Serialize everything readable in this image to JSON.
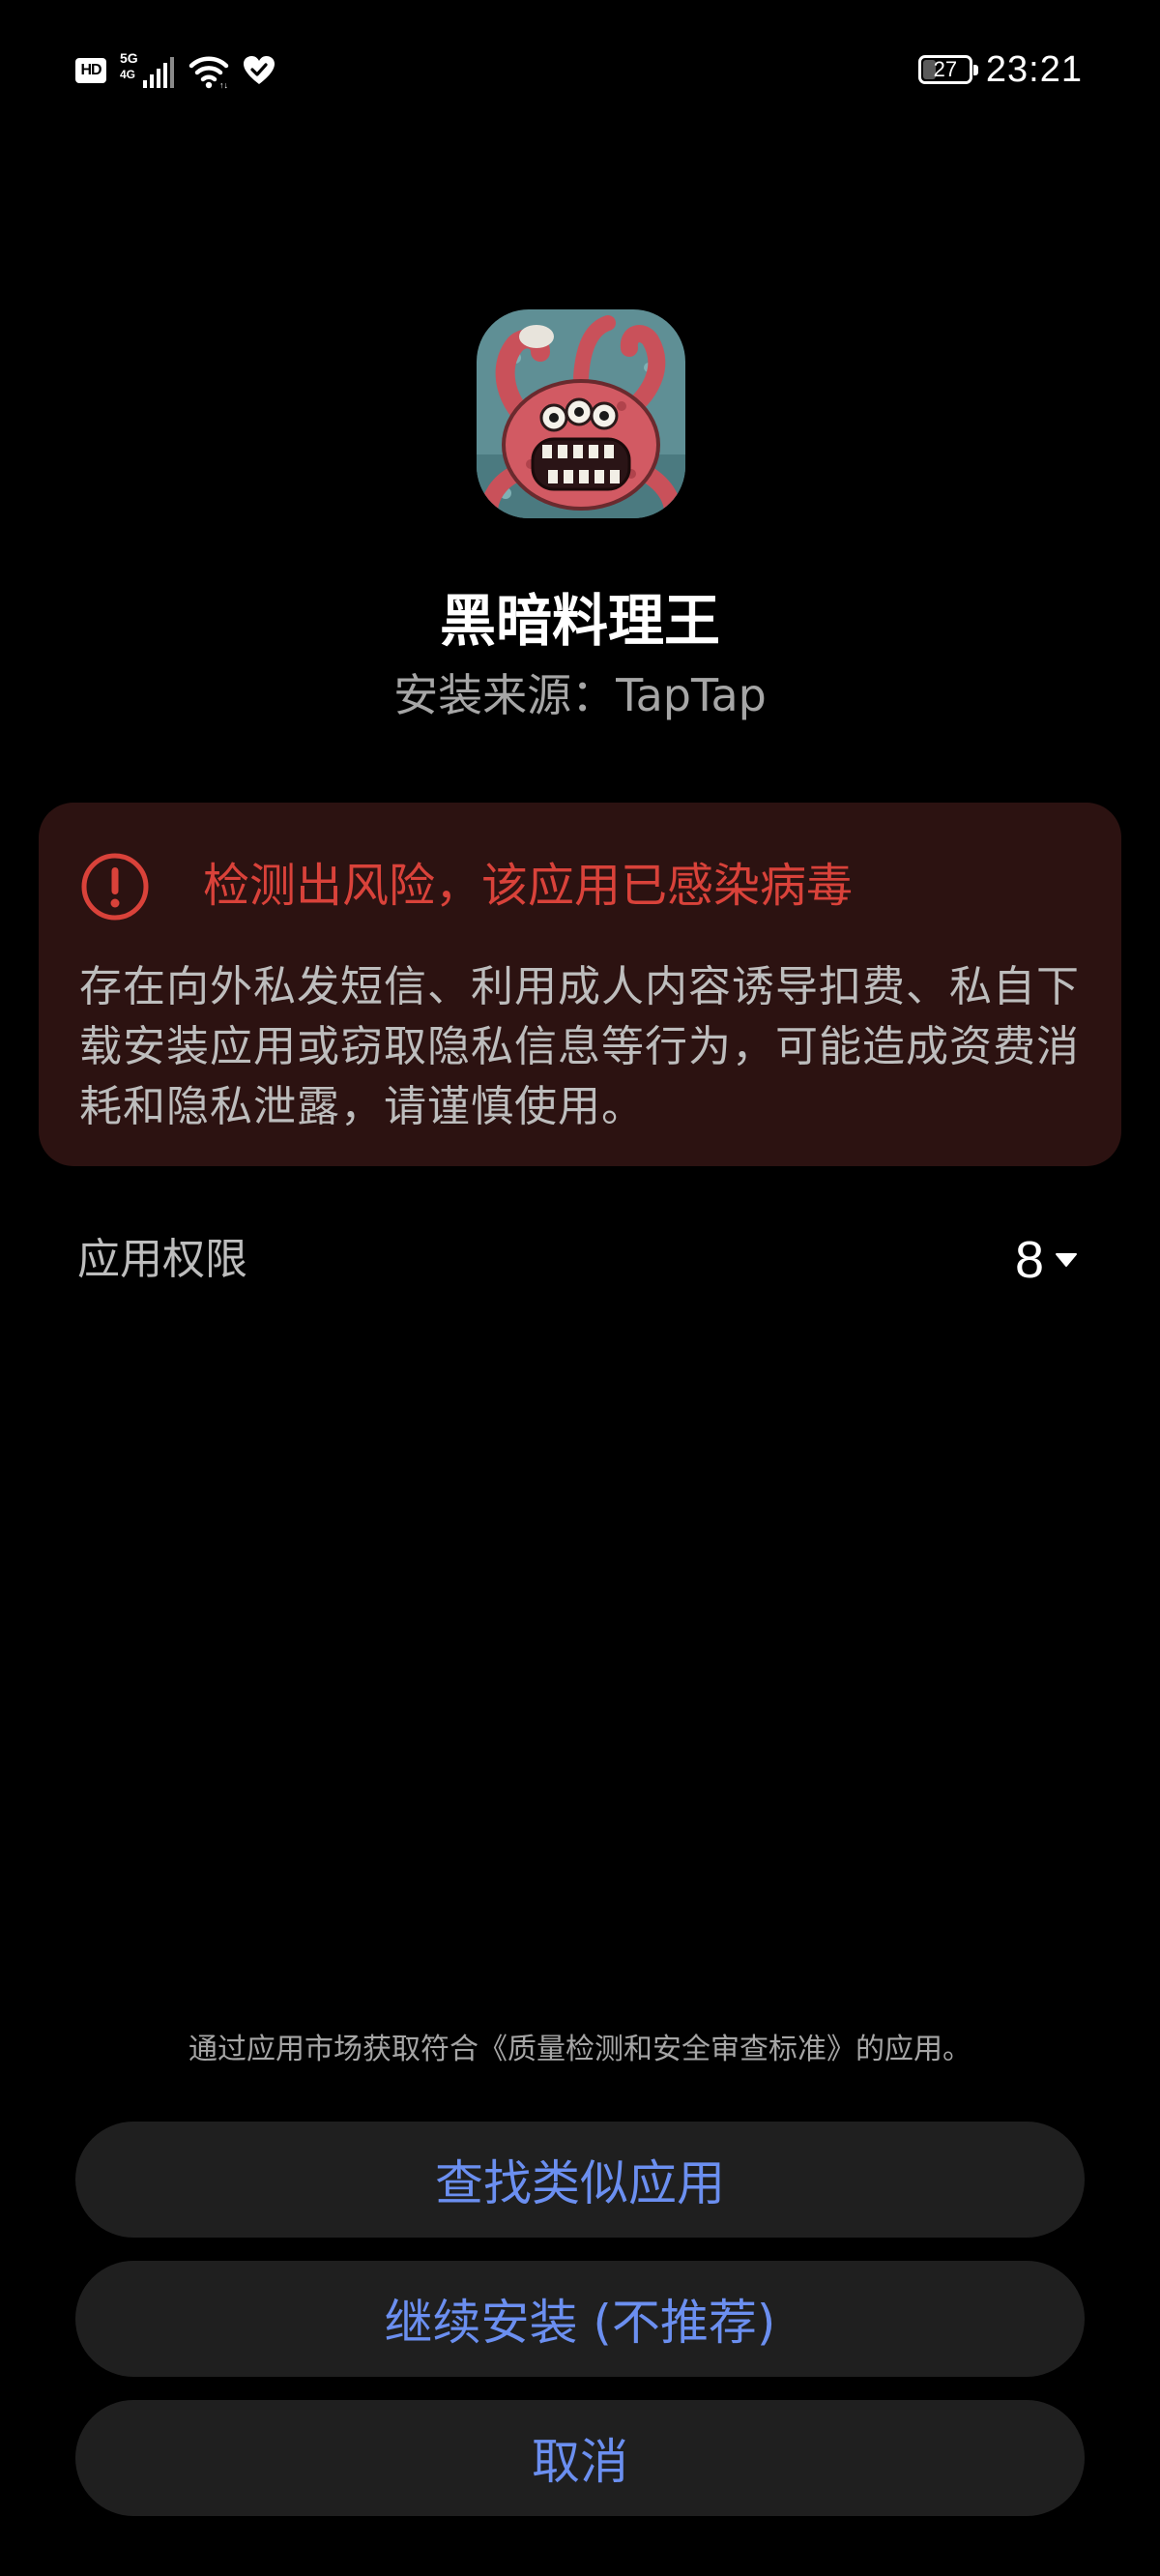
{
  "status_bar": {
    "hd": "HD",
    "network_type": "5G",
    "network_sub": "4G",
    "battery_level": "27",
    "battery_fraction": 0.27,
    "time": "23:21",
    "icons": [
      "hd-icon",
      "signal-icon",
      "wifi-icon",
      "heart-shield-icon",
      "battery-icon"
    ]
  },
  "app": {
    "name": "黑暗料理王",
    "install_source": "安装来源：TapTap",
    "icon": "octopus-monster-app-icon"
  },
  "risk": {
    "icon": "alert-circle-icon",
    "title": "检测出风险，该应用已感染病毒",
    "description": "存在向外私发短信、利用成人内容诱导扣费、私自下载安装应用或窃取隐私信息等行为，可能造成资费消耗和隐私泄露，请谨慎使用。",
    "accent_color": "#d9423a",
    "background_color": "#2c1211"
  },
  "permissions": {
    "label": "应用权限",
    "count": "8",
    "icon": "caret-down-icon"
  },
  "footer": {
    "hint": "通过应用市场获取符合《质量检测和安全审查标准》的应用。",
    "buttons": {
      "find_similar": "查找类似应用",
      "continue_install": "继续安装 (不推荐)",
      "cancel": "取消"
    },
    "button_color": "#6b8ff0"
  }
}
